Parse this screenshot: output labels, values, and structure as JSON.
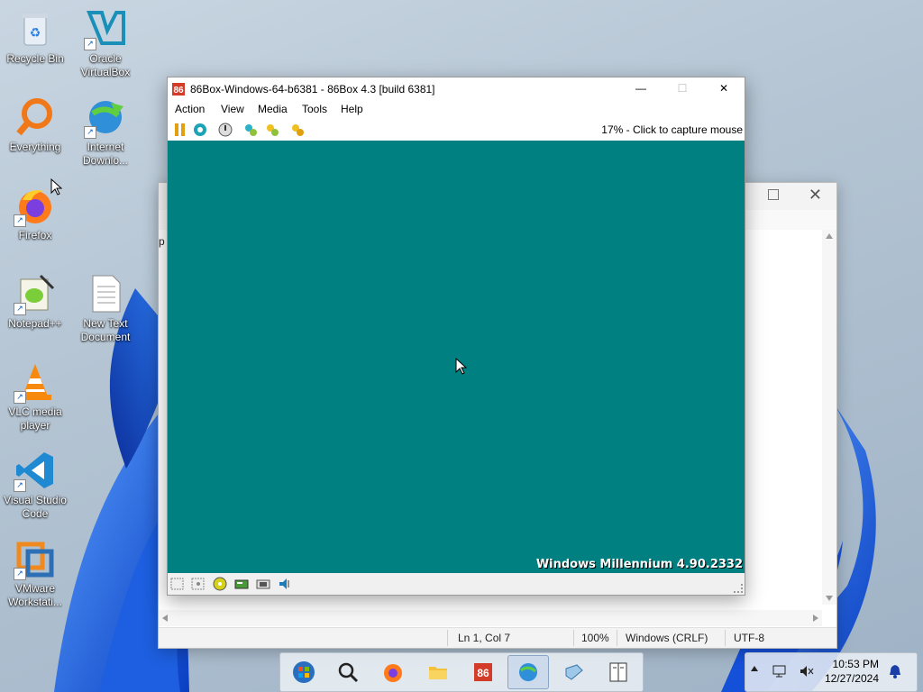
{
  "desktop": {
    "icons": [
      {
        "label": "Recycle Bin"
      },
      {
        "label": "Oracle\nVirtualBox"
      },
      {
        "label": "Everything"
      },
      {
        "label": "Internet\nDownlo..."
      },
      {
        "label": "Firefox"
      },
      {
        "label": "Notepad++"
      },
      {
        "label": "New Text\nDocument"
      },
      {
        "label": "VLC media\nplayer"
      },
      {
        "label": "Visual Studio\nCode"
      },
      {
        "label": "VMware\nWorkstati..."
      }
    ]
  },
  "vm_window": {
    "title": "86Box-Windows-64-b6381 - 86Box 4.3 [build 6381]",
    "controls": {
      "minimize": "—",
      "maximize": "☐",
      "close": "✕"
    },
    "menu": [
      "Action",
      "View",
      "Media",
      "Tools",
      "Help"
    ],
    "capture_status": "17% - Click to capture mouse",
    "screen_color": "#008080",
    "os_version": "Windows Millennium 4.90.2332"
  },
  "notepad_window": {
    "peek_text": "p",
    "status": {
      "position": "Ln 1, Col 7",
      "zoom": "100%",
      "line_ending": "Windows (CRLF)",
      "encoding": "UTF-8"
    }
  },
  "taskbar": {
    "apps": [
      "start-orb-icon",
      "search-icon",
      "firefox-icon",
      "file-explorer-icon",
      "86box-icon",
      "internet-download-manager-icon",
      "virtualbox-icon",
      "notepad-icon"
    ],
    "clock": {
      "time": "10:53 PM",
      "date": "12/27/2024"
    }
  }
}
